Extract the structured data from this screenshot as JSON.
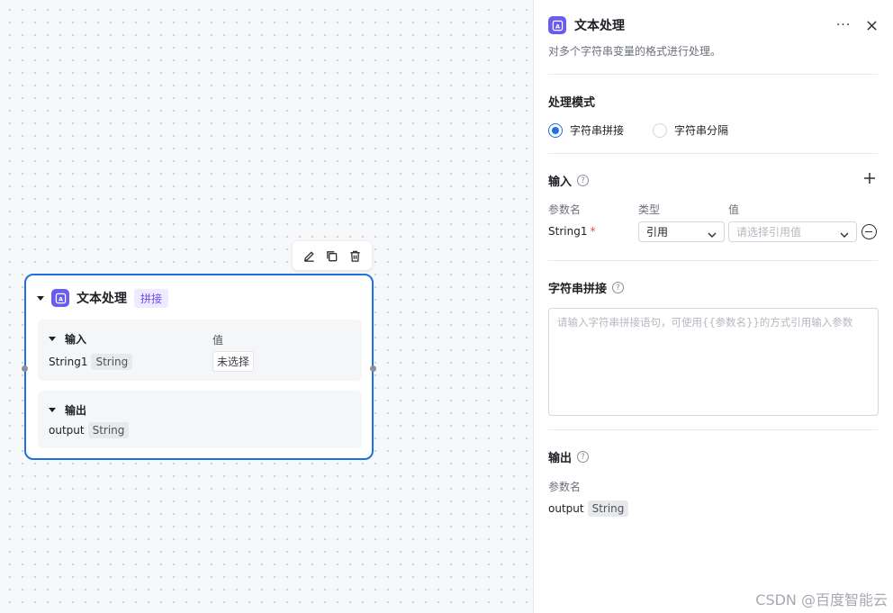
{
  "node": {
    "title": "文本处理",
    "mode_tag": "拼接",
    "input": {
      "header": "输入",
      "value_col": "值",
      "param": "String1",
      "type": "String",
      "value": "未选择"
    },
    "output": {
      "header": "输出",
      "param": "output",
      "type": "String"
    }
  },
  "panel": {
    "title": "文本处理",
    "more": "···",
    "description": "对多个字符串变量的格式进行处理。",
    "mode_section": {
      "title": "处理模式",
      "options": [
        "字符串拼接",
        "字符串分隔"
      ],
      "selected_index": 0
    },
    "input_section": {
      "title": "输入",
      "help": "?",
      "columns": {
        "name": "参数名",
        "type": "类型",
        "value": "值"
      },
      "row": {
        "name": "String1",
        "required_mark": "*",
        "type": "引用",
        "value_placeholder": "请选择引用值"
      }
    },
    "concat_section": {
      "title": "字符串拼接",
      "help": "?",
      "placeholder": "请输入字符串拼接语句，可使用{{参数名}}的方式引用输入参数"
    },
    "output_section": {
      "title": "输出",
      "help": "?",
      "column": "参数名",
      "name": "output",
      "type": "String"
    }
  },
  "watermark": "CSDN @百度智能云",
  "colors": {
    "accent": "#1f6fe5",
    "icon_purple": "#6a5cf0",
    "tag_bg": "#efeaff",
    "tag_text": "#6a4ef0"
  }
}
